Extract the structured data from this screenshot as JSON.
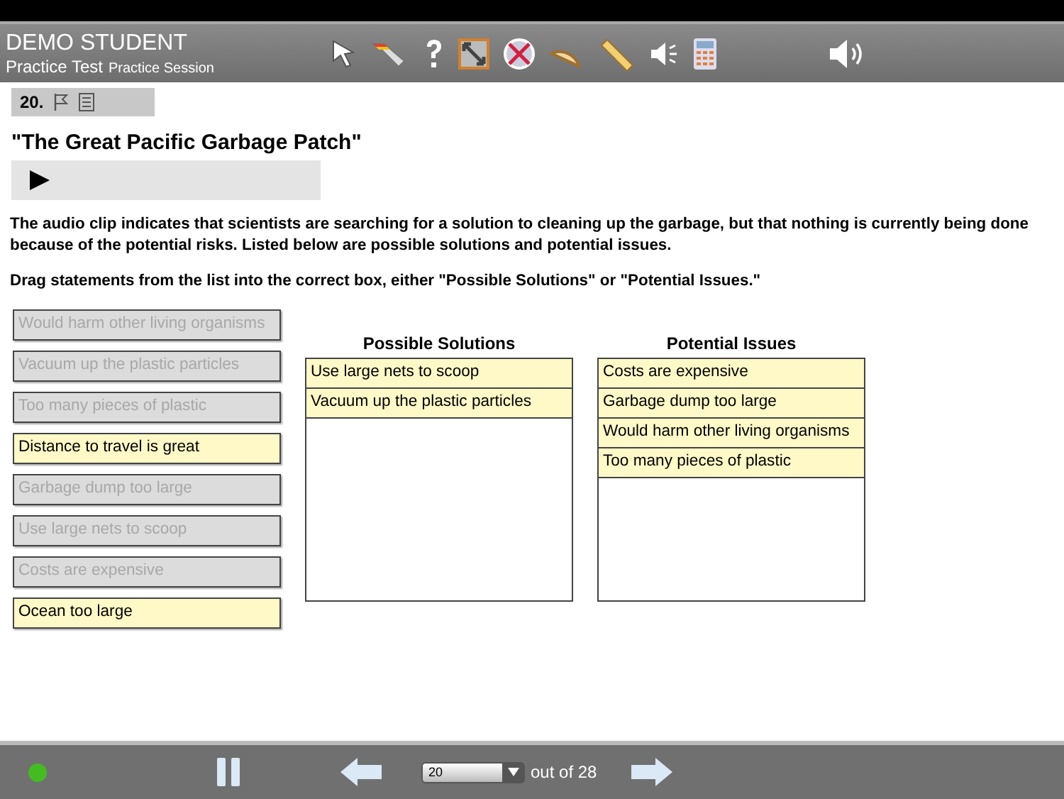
{
  "header": {
    "student": "DEMO STUDENT",
    "test": "Practice Test",
    "session": "Practice Session"
  },
  "question": {
    "number": "20.",
    "flagged": false
  },
  "title": "\"The Great Pacific Garbage Patch\"",
  "audio": {
    "playing": false
  },
  "paragraphs": [
    "The audio clip indicates that scientists are searching for a solution to cleaning up the garbage, but that nothing is currently being done because of the potential risks. Listed below are possible solutions and potential issues.",
    "Drag statements from the list into the correct box, either \"Possible Solutions\" or \"Potential Issues.\""
  ],
  "statements": [
    {
      "text": "Would harm other living organisms",
      "used": true
    },
    {
      "text": "Vacuum up the plastic particles",
      "used": true
    },
    {
      "text": "Too many pieces of plastic",
      "used": true
    },
    {
      "text": "Distance to travel is great",
      "used": false
    },
    {
      "text": "Garbage dump too large",
      "used": true
    },
    {
      "text": "Use large nets to scoop",
      "used": true
    },
    {
      "text": "Costs are expensive",
      "used": true
    },
    {
      "text": "Ocean too large",
      "used": false
    }
  ],
  "boxes": [
    {
      "heading": "Possible Solutions",
      "items": [
        "Use large nets to scoop",
        "Vacuum up the plastic particles"
      ]
    },
    {
      "heading": "Potential Issues",
      "items": [
        "Costs are expensive",
        "Garbage dump too large",
        "Would harm other living organisms",
        "Too many pieces of plastic"
      ]
    }
  ],
  "footer": {
    "connected": true,
    "page_select": "20",
    "out_of": "out of 28"
  }
}
